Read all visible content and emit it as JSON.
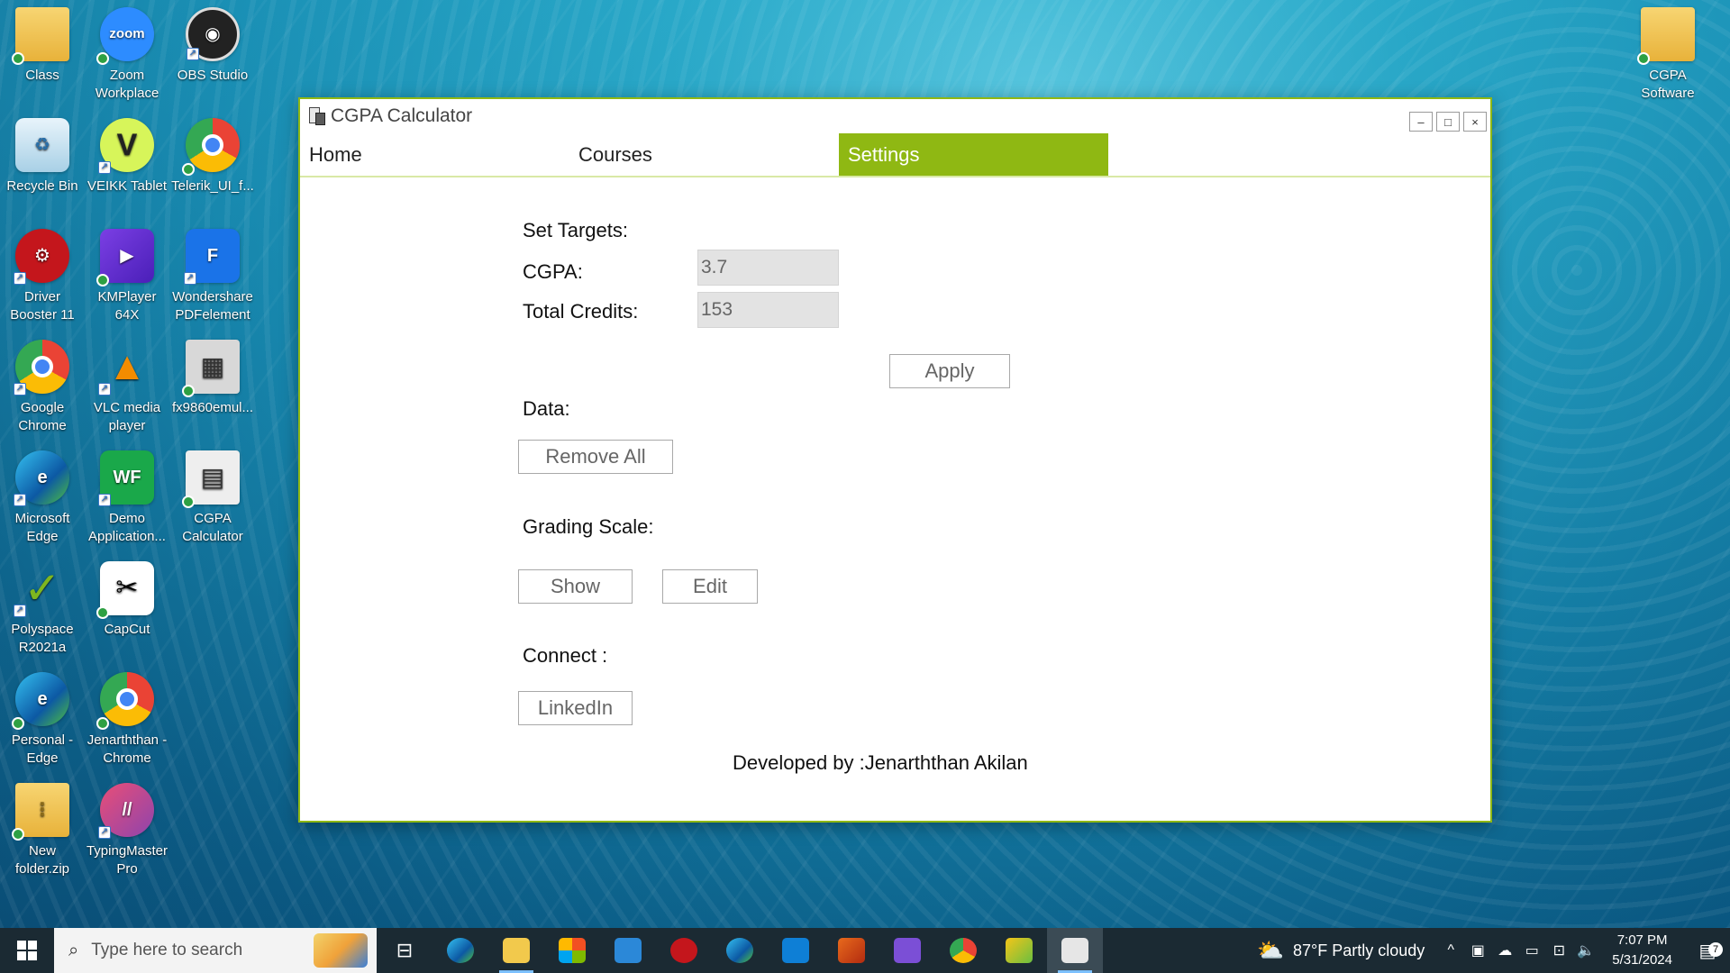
{
  "desktop": {
    "icons": [
      {
        "label": "Class",
        "icon": "folder-icon"
      },
      {
        "label": "Zoom Workplace",
        "icon": "zoom-icon"
      },
      {
        "label": "OBS Studio",
        "icon": "obs-icon"
      },
      {
        "label": "Recycle Bin",
        "icon": "recycle-bin-icon"
      },
      {
        "label": "VEIKK Tablet",
        "icon": "veikk-icon"
      },
      {
        "label": "Telerik_UI_f...",
        "icon": "chrome-icon"
      },
      {
        "label": "Driver Booster 11",
        "icon": "driver-booster-icon"
      },
      {
        "label": "KMPlayer 64X",
        "icon": "kmplayer-icon"
      },
      {
        "label": "Wondershare PDFelement",
        "icon": "pdfelement-icon"
      },
      {
        "label": "Google Chrome",
        "icon": "chrome-icon"
      },
      {
        "label": "VLC media player",
        "icon": "vlc-icon"
      },
      {
        "label": "fx9860emul...",
        "icon": "calculator-icon"
      },
      {
        "label": "Microsoft Edge",
        "icon": "edge-icon"
      },
      {
        "label": "Demo Application...",
        "icon": "wf-icon"
      },
      {
        "label": "CGPA Calculator",
        "icon": "cgpa-calculator-icon"
      },
      {
        "label": "Polyspace R2021a",
        "icon": "polyspace-icon"
      },
      {
        "label": "CapCut",
        "icon": "capcut-icon"
      },
      {
        "label": "Personal - Edge",
        "icon": "edge-icon"
      },
      {
        "label": "Jenarththan - Chrome",
        "icon": "chrome-icon"
      },
      {
        "label": "New folder.zip",
        "icon": "zip-folder-icon"
      },
      {
        "label": "TypingMaster Pro",
        "icon": "typingmaster-icon"
      },
      {
        "label": "CGPA Software",
        "icon": "folder-icon"
      }
    ]
  },
  "window": {
    "title": "CGPA Calculator",
    "controls": {
      "minimize": "–",
      "maximize": "□",
      "close": "×"
    },
    "accent_color": "#8fb813"
  },
  "nav": {
    "tabs": [
      {
        "label": "Home",
        "active": false
      },
      {
        "label": "Courses",
        "active": false
      },
      {
        "label": "Settings",
        "active": true
      }
    ]
  },
  "settings": {
    "set_targets_label": "Set Targets:",
    "cgpa_label": "CGPA:",
    "cgpa_value": "3.7",
    "total_credits_label": "Total Credits:",
    "total_credits_value": "153",
    "apply_button": "Apply",
    "data_label": "Data:",
    "remove_all_button": "Remove All",
    "grading_scale_label": "Grading Scale:",
    "show_button": "Show",
    "edit_button": "Edit",
    "connect_label": "Connect :",
    "linkedin_button": "LinkedIn",
    "developer_credit": "Developed by :Jenarththan Akilan"
  },
  "taskbar": {
    "search_placeholder": "Type here to search",
    "weather": "87°F  Partly cloudy",
    "time": "7:07 PM",
    "date": "5/31/2024",
    "notification_count": "7"
  }
}
